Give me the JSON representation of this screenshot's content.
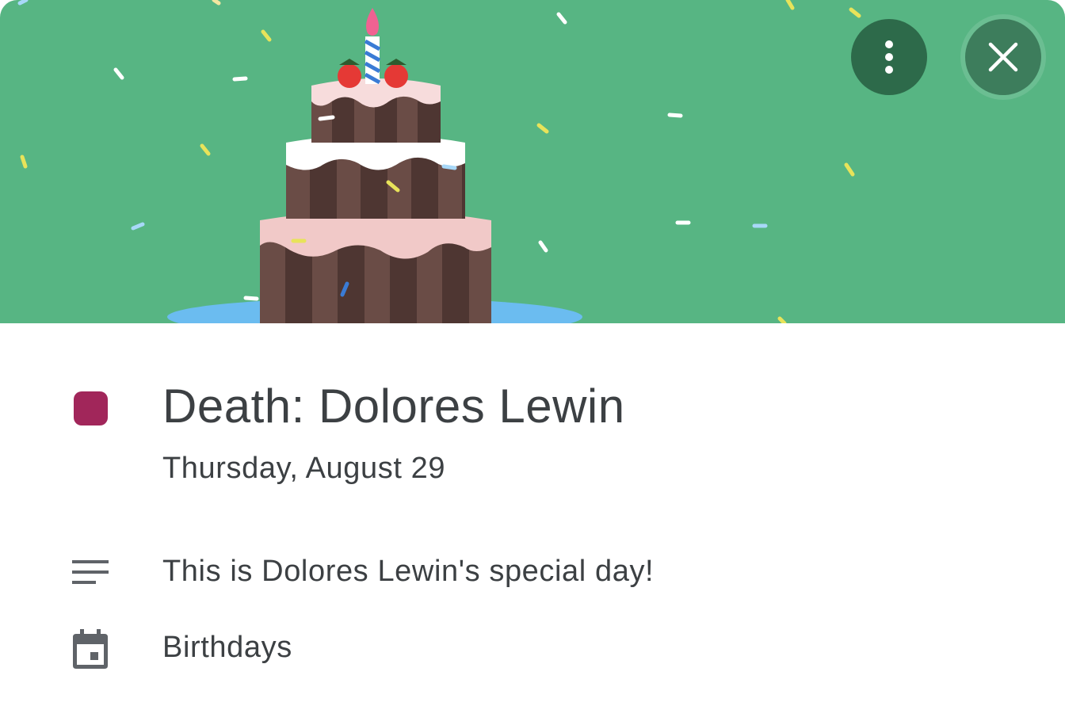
{
  "event": {
    "title": "Death: Dolores Lewin",
    "date": "Thursday, August 29",
    "description": "This is Dolores Lewin's special day!",
    "calendar": "Birthdays",
    "color": "#a1265a"
  },
  "banner": {
    "background_color": "#57b583",
    "illustration": "birthday-cake"
  },
  "actions": {
    "more_icon": "more-vert-icon",
    "close_icon": "close-icon"
  },
  "icons": {
    "description": "notes-icon",
    "calendar": "calendar-icon"
  }
}
